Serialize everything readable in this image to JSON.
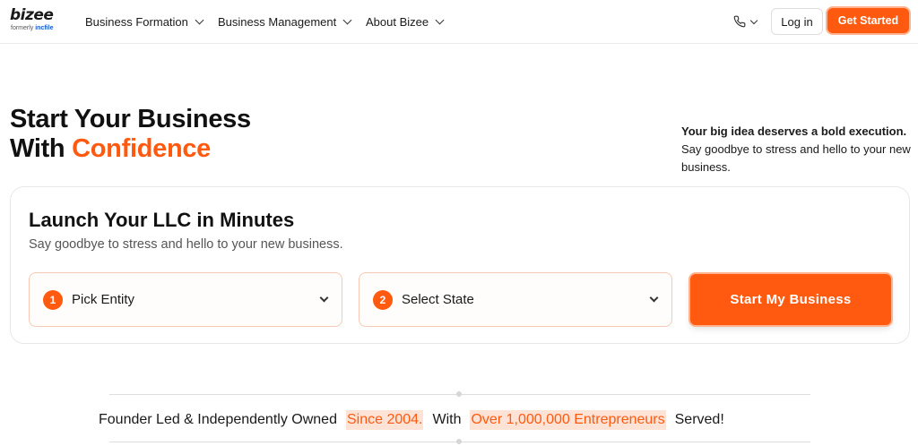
{
  "header": {
    "logo": {
      "name": "bizee",
      "formerly_prefix": "formerly ",
      "formerly_brand": "incfile"
    },
    "nav": [
      {
        "label": "Business Formation"
      },
      {
        "label": "Business Management"
      },
      {
        "label": "About Bizee"
      }
    ],
    "phone_icon": "phone-icon",
    "login_label": "Log in",
    "get_started_label": "Get Started"
  },
  "hero": {
    "title_line1": "Start Your Business",
    "title_line2_prefix": "With ",
    "title_line2_accent": "Confidence",
    "right_bold": "Your big idea deserves a bold execution.",
    "right_text": "Say goodbye to stress and hello to your new business."
  },
  "card": {
    "title": "Launch Your LLC in Minutes",
    "subtitle": "Say goodbye to stress and hello to your new business.",
    "selects": [
      {
        "step": "1",
        "label": "Pick Entity"
      },
      {
        "step": "2",
        "label": "Select State"
      }
    ],
    "cta_label": "Start My Business"
  },
  "tagline": {
    "part1": "Founder Led & Independently Owned",
    "highlight1": "Since 2004.",
    "part2": "With",
    "highlight2": "Over 1,000,000 Entrepreneurs",
    "part3": "Served!"
  },
  "colors": {
    "accent": "#ff5a10",
    "highlight_bg": "#fde3d6",
    "brand_blue": "#1c58c9"
  }
}
